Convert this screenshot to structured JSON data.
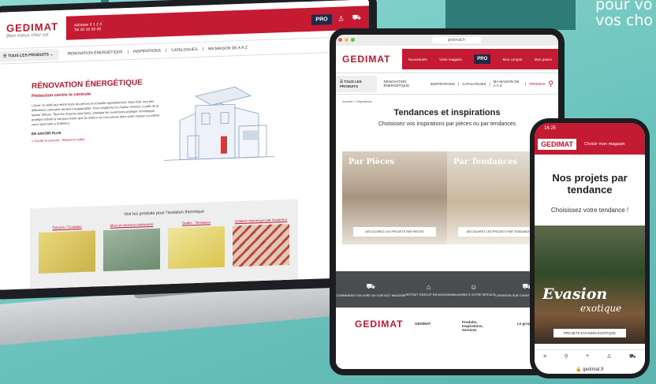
{
  "overlay_text": [
    "pour vo",
    "vos cho"
  ],
  "laptop": {
    "logo": "GEDIMAT",
    "logo_tagline": "Bien mieux chez soi",
    "header_contact": [
      "Adresse 0 1 2 3",
      "Tel 00 00 00 00"
    ],
    "pro_badge": "PRO",
    "nav": {
      "menu_label": "TOUS LES PRODUITS",
      "items": [
        "RÉNOVATION ÉNERGÉTIQUE",
        "INSPIRATIONS",
        "CATALOGUES",
        "MA MAISON DE A À Z"
      ]
    },
    "article": {
      "title": "RÉNOVATION ÉNERGÉTIQUE",
      "subtitle": "Protection contre la canicule",
      "body": "L'hiver, le soleil qui rentre dans les pièces et échauffe agréablement. Mais l'été, lors des différentes canicules devient insupportable. Pour empêcher la chaleur d'entrer, il suffit de la laisser dehors. Tous les moyens sont bons: protéger les ouvertures protéger l'enveloppe, protéger même le toit pour éviter que la chaleur ne s'accumule dans votre maison ou même vous rayonnant à l'intérieur.",
      "more_label": "EN SAVOIR PLUS",
      "link": "> Contre la canicule : bloquer le soleil"
    },
    "products": {
      "title": "Voir les produits pour l'isolation thermique",
      "cards": [
        "Toitures / Combles",
        "Murs et cloisons intérieures",
        "Dalles - Terrasses",
        "Isolation thermique par l'extérieur"
      ]
    }
  },
  "tablet": {
    "url": "gedimat.fr",
    "logo": "GEDIMAT",
    "header_items": [
      "Nouveautés",
      "Votre magasin",
      "PRO",
      "Mon compte",
      "Mon panier"
    ],
    "nav": {
      "menu_label": "TOUS LES PRODUITS",
      "items": [
        "RÉNOVATION ÉNERGÉTIQUE",
        "INSPIRATIONS",
        "CATALOGUES",
        "MA MAISON DE A À Z",
        "PROMOS"
      ]
    },
    "breadcrumb": "Accueil > Inspirations",
    "title": "Tendances et inspirations",
    "subtitle": "Choisissez vos inspirations par pièces ou par tendances",
    "cards": [
      {
        "label": "Par Pièces",
        "button": "DÉCOUVREZ LES PROJETS PAR PIÈCES"
      },
      {
        "label": "Par Tendances",
        "button": "DÉCOUVREZ LES PROJETS PAR TENDANCES"
      }
    ],
    "services": [
      {
        "icon": "cart-icon",
        "label": "COMMANDEZ VIA LIVRE OU CONTACT MAGASIN"
      },
      {
        "icon": "store-icon",
        "label": "RETRAIT GRATUIT EN MAGASIN"
      },
      {
        "icon": "advice-icon",
        "label": "MAGASINS À VOTRE SERVICE"
      },
      {
        "icon": "truck-icon",
        "label": "LIVRAISON SUR CHANTIER OU À DOMICILE"
      }
    ],
    "footer": {
      "logo": "GEDIMAT",
      "columns": [
        "GEDIMAT",
        "Produits, Inspirations, Services",
        "Le groupe"
      ]
    }
  },
  "phone": {
    "time": "16:25",
    "logo": "GEDIMAT",
    "store_label": "Choisir mon magasin",
    "title": "Nos projets par tendance",
    "subtitle": "Choisissez votre tendance !",
    "hero_title": "Evasion",
    "hero_subtitle": "exotique",
    "hero_button": "PROJETS EVASION EXOTIQUE",
    "url": "gedimat.fr"
  },
  "colors": {
    "brand_red": "#c41a32",
    "background_teal": "#7fcdc8",
    "dark_blue": "#1f2a48"
  }
}
